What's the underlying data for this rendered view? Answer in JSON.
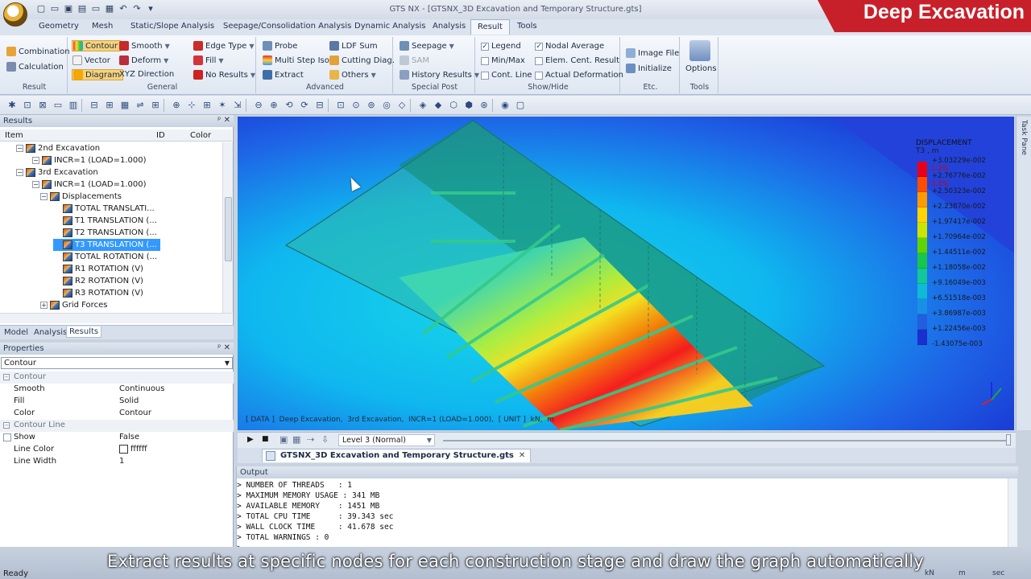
{
  "window": {
    "title": "GTS NX - [GTSNX_3D Excavation and Temporary Structure.gts]",
    "brand": "Deep Excavation"
  },
  "ribbon_tabs": [
    "Geometry",
    "Mesh",
    "Static/Slope Analysis",
    "Seepage/Consolidation Analysis",
    "Dynamic Analysis",
    "Analysis",
    "Result",
    "Tools"
  ],
  "ribbon": {
    "result": {
      "label": "Result",
      "items": [
        "Combination",
        "Calculation"
      ]
    },
    "general": {
      "label": "General",
      "col1": [
        "Contour",
        "Vector",
        "Diagram"
      ],
      "col2": [
        "Smooth",
        "Deform",
        "XYZ Direction"
      ],
      "col3": [
        "Edge Type",
        "Fill",
        "No Results"
      ]
    },
    "advanced": {
      "label": "Advanced",
      "col1": [
        "Probe",
        "Multi Step Iso.",
        "Extract"
      ],
      "col2": [
        "LDF Sum",
        "Cutting Diag.",
        "Others"
      ]
    },
    "special_post": {
      "label": "Special Post",
      "items": [
        "Seepage",
        "SAM",
        "History Results"
      ]
    },
    "show_hide": {
      "label": "Show/Hide",
      "col1": [
        {
          "label": "Legend",
          "checked": true
        },
        {
          "label": "Min/Max",
          "checked": false
        },
        {
          "label": "Cont. Line",
          "checked": false
        }
      ],
      "col2": [
        {
          "label": "Nodal Average",
          "checked": true
        },
        {
          "label": "Elem. Cent. Result",
          "checked": false
        },
        {
          "label": "Actual Deformation",
          "checked": false
        }
      ]
    },
    "etc": {
      "label": "Etc.",
      "items": [
        "Image File",
        "Initialize"
      ]
    },
    "tools": {
      "label": "Tools",
      "items": [
        "Options"
      ]
    }
  },
  "results_panel": {
    "title": "Results",
    "columns": [
      "Item",
      "ID",
      "Color"
    ],
    "tree": [
      "2nd Excavation",
      "INCR=1 (LOAD=1.000)",
      "3rd Excavation",
      "INCR=1 (LOAD=1.000)",
      "Displacements",
      "TOTAL TRANSLATI...",
      "T1 TRANSLATION (...",
      "T2 TRANSLATION (...",
      "T3 TRANSLATION (...",
      "TOTAL ROTATION (...",
      "R1 ROTATION (V)",
      "R2 ROTATION (V)",
      "R3 ROTATION (V)",
      "Grid Forces"
    ],
    "selected_index": 8,
    "tabs": [
      "Model",
      "Analysis",
      "Results"
    ],
    "active_tab": "Results"
  },
  "properties_panel": {
    "title": "Properties",
    "selected": "Contour",
    "rows": [
      {
        "type": "category",
        "key": "Contour"
      },
      {
        "type": "row",
        "key": "Smooth",
        "value": "Continuous"
      },
      {
        "type": "row",
        "key": "Fill",
        "value": "Solid"
      },
      {
        "type": "row",
        "key": "Color",
        "value": "Contour"
      },
      {
        "type": "category",
        "key": "Contour Line"
      },
      {
        "type": "row",
        "key": "Show",
        "value": "False",
        "checkbox": true
      },
      {
        "type": "row",
        "key": "Line Color",
        "value": "ffffff",
        "swatch": true
      },
      {
        "type": "row",
        "key": "Line Width",
        "value": "1"
      }
    ]
  },
  "viewport": {
    "caption": "[ DATA ]  Deep Excavation,  3rd Excavation,  INCR=1 (LOAD=1.000),  [ UNIT ]  kN,  m",
    "legend": {
      "title": "DISPLACEMENT",
      "subtitle": "T3 , m",
      "percent_labels": [
        "1.2%",
        "3.1%"
      ],
      "values": [
        "+3.03229e-002",
        "+2.76776e-002",
        "+2.50323e-002",
        "+2.23870e-002",
        "+1.97417e-002",
        "+1.70964e-002",
        "+1.44511e-002",
        "+1.18058e-002",
        "+9.16049e-003",
        "+6.51518e-003",
        "+3.86987e-003",
        "+1.22456e-003",
        "-1.43075e-003"
      ],
      "colors": [
        "#e8001a",
        "#ff4d00",
        "#ff9a00",
        "#ffd400",
        "#c8e600",
        "#5fd400",
        "#17c64b",
        "#12c79a",
        "#10b9d6",
        "#1a8fe6",
        "#1f5fe0",
        "#1a2fd0"
      ]
    }
  },
  "task_pane": "Task Pane",
  "stage_bar": {
    "level": "Level 3 (Normal)"
  },
  "document_tab": "GTSNX_3D Excavation and Temporary Structure.gts",
  "output": {
    "title": "Output",
    "lines": [
      "> NUMBER OF THREADS   : 1",
      "> MAXIMUM MEMORY USAGE : 341 MB",
      "> AVAILABLE MEMORY    : 1451 MB",
      "> TOTAL CPU TIME      : 39.343 sec",
      "> WALL CLOCK TIME     : 41.678 sec",
      "> TOTAL WARNINGS : 0",
      ">"
    ]
  },
  "statusbar": {
    "ready": "Ready",
    "units": [
      "kN",
      "m",
      "sec"
    ]
  },
  "subtitle": "Extract results at specific nodes for each construction stage and draw the graph automatically"
}
